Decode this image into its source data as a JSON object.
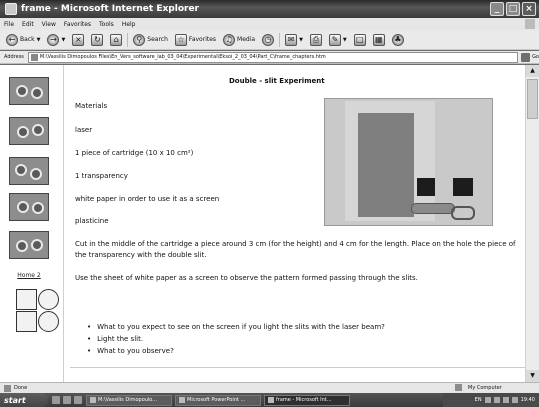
{
  "window": {
    "title": "frame - Microsoft Internet Explorer",
    "controls": [
      "_",
      "□",
      "×"
    ]
  },
  "menu": [
    "File",
    "Edit",
    "View",
    "Favorites",
    "Tools",
    "Help"
  ],
  "toolbar": {
    "back": "Back",
    "search": "Search",
    "favorites": "Favorites",
    "media": "Media"
  },
  "address": {
    "label": "Address",
    "url": "M:\\Vassilis Dimopoulos Files\\En_Vers_software_lab_03_04\\Experimental\\Eksoi_2_03_04\\Part_C\\frame_chapters.htm",
    "go": "Go"
  },
  "sidebar": {
    "home_link": "Home 2"
  },
  "page": {
    "title": "Double - slit  Experiment",
    "materials_heading": "Materials",
    "materials": [
      "laser",
      "1 piece of cartridge (10 x 10 cm²)",
      "1 transparency",
      "white paper in order to use it as a screen",
      "plasticine"
    ],
    "instructions": [
      "Cut in the middle of the cartridge a piece around 3 cm (for the height) and 4 cm for the length. Place on the hole the piece of the transparency with the double slit.",
      "Use the sheet of white paper as a screen to observe the pattern formed passing through the slits."
    ],
    "questions": [
      "What to you expect to see on the screen if you light the slits with the laser beam?",
      "Light the slit.",
      "What to you observe?"
    ]
  },
  "status": {
    "left": "Done",
    "zone": "My Computer"
  },
  "taskbar": {
    "start": "start",
    "tasks": [
      "M:\\Vassilis Dimopoulo...",
      "Microsoft PowerPoint ...",
      "frame - Microsoft Int..."
    ],
    "tray_language": "EN",
    "time": "19:40"
  }
}
